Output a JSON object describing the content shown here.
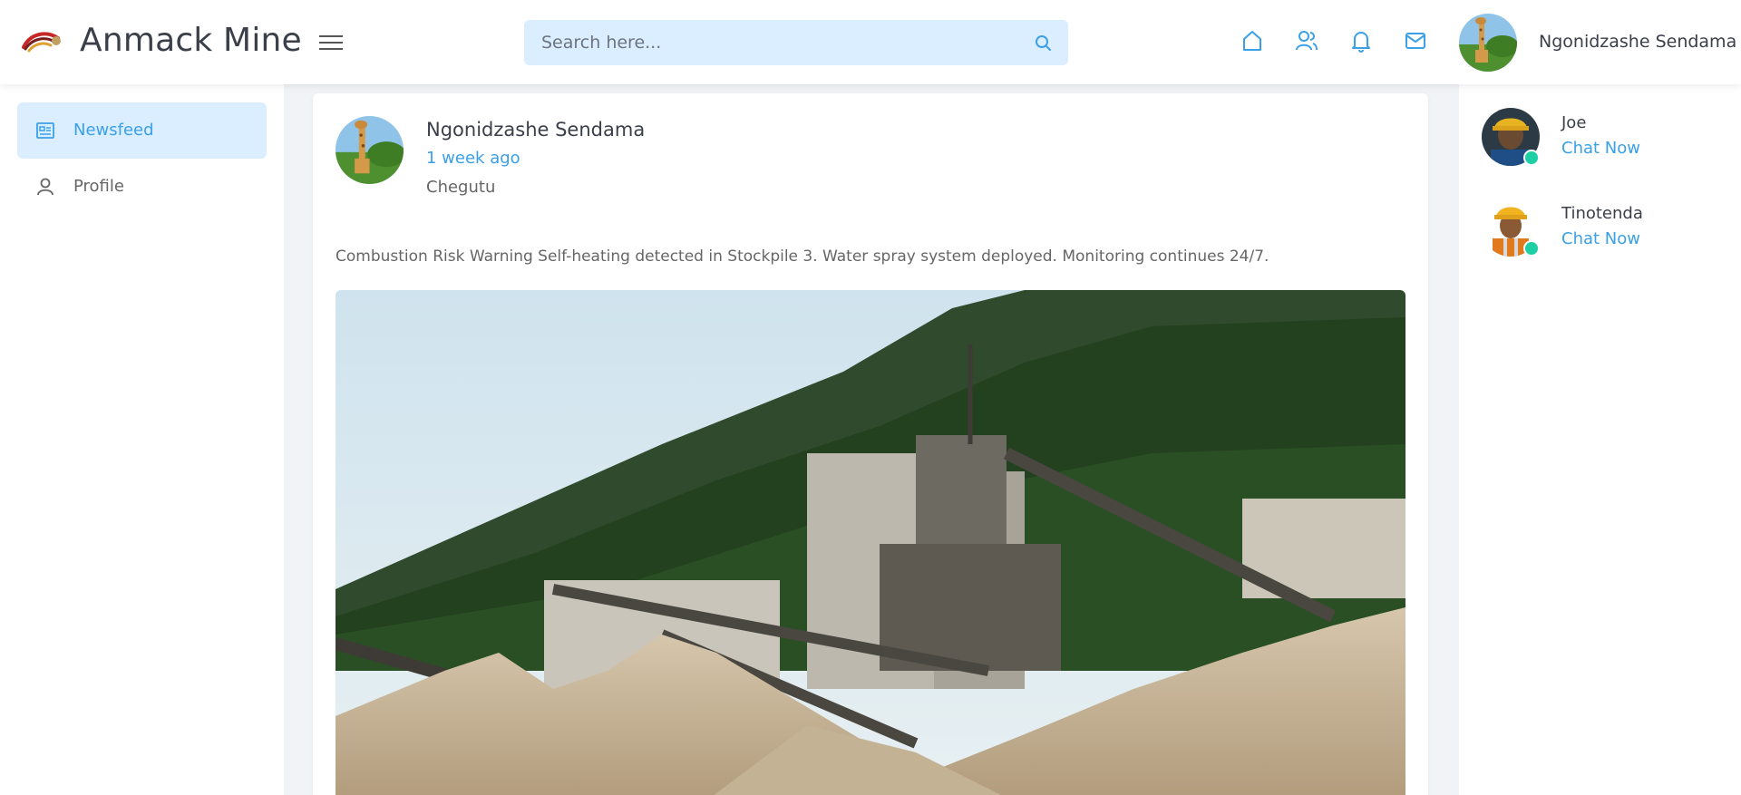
{
  "header": {
    "app_title": "Anmack Mine",
    "menu_icon": "hamburger-menu-icon",
    "search": {
      "placeholder": "Search here...",
      "value": ""
    },
    "nav_icons": [
      "home-icon",
      "friends-icon",
      "notifications-bell-icon",
      "messages-envelope-icon"
    ],
    "user_name": "Ngonidzashe Sendama"
  },
  "left_sidebar": {
    "items": [
      {
        "label": "Newsfeed",
        "icon": "newsfeed-icon",
        "active": true
      },
      {
        "label": "Profile",
        "icon": "user-icon",
        "active": false
      }
    ]
  },
  "post": {
    "author": "Ngonidzashe Sendama",
    "time": "1 week ago",
    "location": "Chegutu",
    "text": "Combustion Risk Warning Self-heating detected in Stockpile 3. Water spray system deployed. Monitoring continues 24/7."
  },
  "right_sidebar": {
    "contacts": [
      {
        "name": "Joe",
        "action": "Chat Now",
        "online": true
      },
      {
        "name": "Tinotenda",
        "action": "Chat Now",
        "online": true
      }
    ]
  },
  "colors": {
    "accent": "#3aa0e8",
    "search_bg": "#dbeeff",
    "online": "#1ecfa6"
  }
}
